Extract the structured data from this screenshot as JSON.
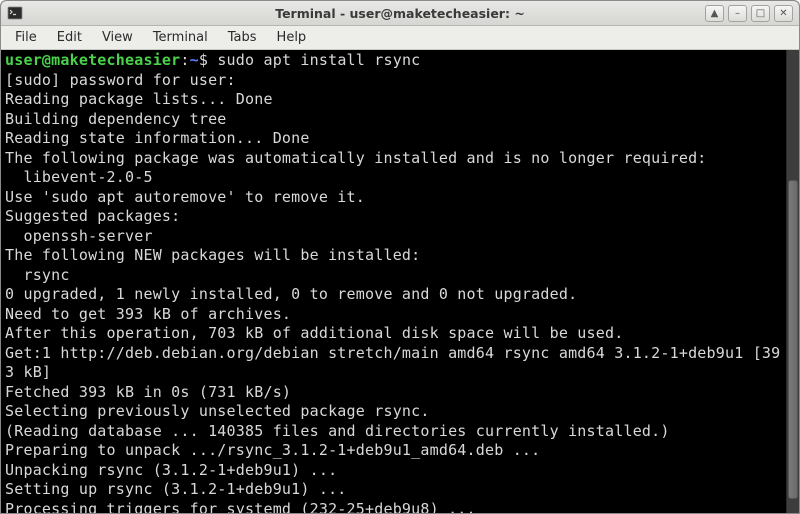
{
  "window": {
    "title": "Terminal - user@maketecheasier: ~"
  },
  "titlebar": {
    "icon_name": "terminal-icon",
    "controls": {
      "shade": "▲",
      "minimize": "–",
      "maximize": "□",
      "close": "✕"
    }
  },
  "menubar": {
    "items": [
      "File",
      "Edit",
      "View",
      "Terminal",
      "Tabs",
      "Help"
    ]
  },
  "prompt": {
    "user_host": "user@maketecheasier",
    "sep": ":",
    "path": "~",
    "symbol": "$",
    "command": "sudo apt install rsync"
  },
  "output_lines": [
    "[sudo] password for user: ",
    "Reading package lists... Done",
    "Building dependency tree       ",
    "Reading state information... Done",
    "The following package was automatically installed and is no longer required:",
    "  libevent-2.0-5",
    "Use 'sudo apt autoremove' to remove it.",
    "Suggested packages:",
    "  openssh-server",
    "The following NEW packages will be installed:",
    "  rsync",
    "0 upgraded, 1 newly installed, 0 to remove and 0 not upgraded.",
    "Need to get 393 kB of archives.",
    "After this operation, 703 kB of additional disk space will be used.",
    "Get:1 http://deb.debian.org/debian stretch/main amd64 rsync amd64 3.1.2-1+deb9u1 [393 kB]",
    "Fetched 393 kB in 0s (731 kB/s) ",
    "Selecting previously unselected package rsync.",
    "(Reading database ... 140385 files and directories currently installed.)",
    "Preparing to unpack .../rsync_3.1.2-1+deb9u1_amd64.deb ...",
    "Unpacking rsync (3.1.2-1+deb9u1) ...",
    "Setting up rsync (3.1.2-1+deb9u1) ...",
    "Processing triggers for systemd (232-25+deb9u8) ..."
  ]
}
